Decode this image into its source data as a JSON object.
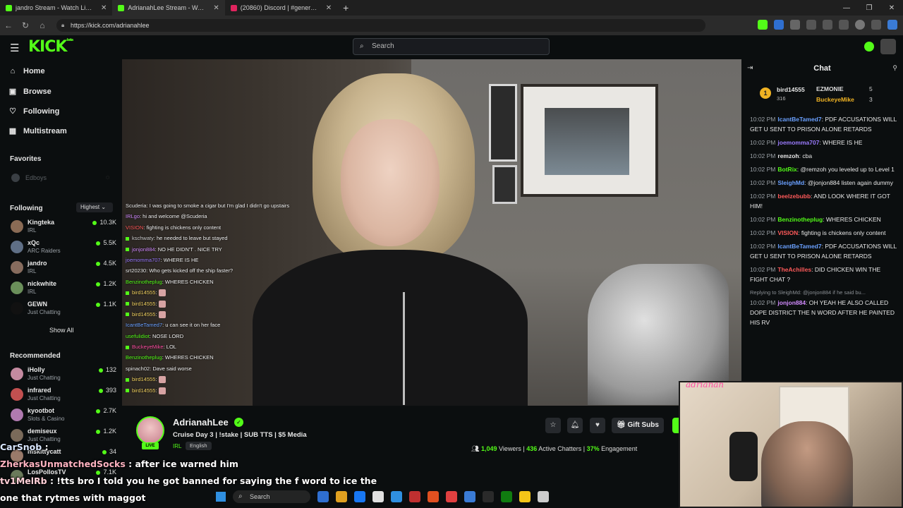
{
  "browser": {
    "tabs": [
      {
        "title": "jandro Stream - Watch Live o",
        "color": "#53fc18",
        "active": false
      },
      {
        "title": "AdrianahLee Stream - Watch",
        "color": "#53fc18",
        "active": true
      },
      {
        "title": "(20860) Discord | #general | H3",
        "color": "#e0245e",
        "active": false
      }
    ],
    "url": "https://kick.com/adrianahlee"
  },
  "header": {
    "logo": "KICK",
    "logo_sup": "beta",
    "search_placeholder": "Search"
  },
  "sidebar": {
    "nav": [
      {
        "label": "Home",
        "icon": "home-icon",
        "glyph": "⌂"
      },
      {
        "label": "Browse",
        "icon": "browse-icon",
        "glyph": "▣"
      },
      {
        "label": "Following",
        "icon": "heart-icon",
        "glyph": "♡"
      },
      {
        "label": "Multistream",
        "icon": "grid-icon",
        "glyph": "▦"
      }
    ],
    "favorites_title": "Favorites",
    "favorite_item": "Edboys",
    "following_title": "Following",
    "sort_label": "Highest",
    "following": [
      {
        "name": "Kingteka",
        "category": "IRL",
        "viewers": "10.3K",
        "color": "#8a6b55"
      },
      {
        "name": "xQc",
        "category": "ARC Raiders",
        "viewers": "5.5K",
        "color": "#5f6f86"
      },
      {
        "name": "jandro",
        "category": "IRL",
        "viewers": "4.5K",
        "color": "#876c5e"
      },
      {
        "name": "nickwhite",
        "category": "IRL",
        "viewers": "1.2K",
        "color": "#6a8f5a"
      },
      {
        "name": "GEWN",
        "category": "Just Chatting",
        "viewers": "1.1K",
        "color": "#111111"
      }
    ],
    "show_all": "Show All",
    "recommended_title": "Recommended",
    "recommended": [
      {
        "name": "iHolly",
        "category": "Just Chatting",
        "viewers": "132",
        "color": "#c48aa0"
      },
      {
        "name": "infrared",
        "category": "Just Chatting",
        "viewers": "393",
        "color": "#c25050"
      },
      {
        "name": "kyootbot",
        "category": "Slots & Casino",
        "viewers": "2.7K",
        "color": "#b07ab0"
      },
      {
        "name": "demiseux",
        "category": "Just Chatting",
        "viewers": "1.2K",
        "color": "#7a6a5a"
      },
      {
        "name": "mskittycatt",
        "category": "",
        "viewers": "34",
        "color": "#9a7a6a"
      },
      {
        "name": "LosPollosTV",
        "category": "",
        "viewers": "7.1K",
        "color": "#6a7a5a"
      }
    ]
  },
  "video_chat": [
    {
      "user": "Scuderia",
      "text": ": I was going to smoke a cigar but I'm glad I didn't go upstairs",
      "color": "#e8e8e8",
      "badge": false,
      "emote": false
    },
    {
      "user": "IRLgo",
      "text": ": hi and welcome @Scuderia",
      "color": "#d28bff",
      "badge": false,
      "emote": false
    },
    {
      "user": "VISION",
      "text": ": fighting is chickens only content",
      "color": "#ff5a5a",
      "badge": false,
      "emote": false
    },
    {
      "user": "kschwaty",
      "text": ": he needed to leave but stayed",
      "color": "#cfcfcf",
      "badge": true,
      "emote": false
    },
    {
      "user": "jonjon884",
      "text": ": NO HE DIDN'T . NICE TRY",
      "color": "#d28bff",
      "badge": true,
      "emote": false
    },
    {
      "user": "joemomma707",
      "text": ": WHERE IS HE",
      "color": "#9b7bff",
      "badge": false,
      "emote": false
    },
    {
      "user": "srt20230",
      "text": ": Who gets kicked off the ship faster?",
      "color": "#e8e8e8",
      "badge": false,
      "emote": false
    },
    {
      "user": "Benzinotheplug",
      "text": ": WHERES CHICKEN",
      "color": "#53fc18",
      "badge": false,
      "emote": false
    },
    {
      "user": "bird14555",
      "text": ":",
      "color": "#f0d060",
      "badge": true,
      "emote": true
    },
    {
      "user": "bird14555",
      "text": ":",
      "color": "#f0d060",
      "badge": true,
      "emote": true
    },
    {
      "user": "bird14555",
      "text": ":",
      "color": "#f0d060",
      "badge": true,
      "emote": true
    },
    {
      "user": "IcantBeTamed7",
      "text": ": u can see it on her face",
      "color": "#6aa0ff",
      "badge": false,
      "emote": false
    },
    {
      "user": "usefulidiot",
      "text": ": NOSE LORD",
      "color": "#53fc18",
      "badge": false,
      "emote": false
    },
    {
      "user": "BuckeyeMike",
      "text": ": LOL",
      "color": "#ff4fa3",
      "badge": true,
      "emote": false
    },
    {
      "user": "Benzinotheplug",
      "text": ": WHERES CHICKEN",
      "color": "#53fc18",
      "badge": false,
      "emote": false
    },
    {
      "user": "spinach02",
      "text": ": Dave said worse",
      "color": "#e8e8e8",
      "badge": false,
      "emote": false
    },
    {
      "user": "bird14555",
      "text": ":",
      "color": "#f0d060",
      "badge": true,
      "emote": true
    },
    {
      "user": "bird14555",
      "text": ":",
      "color": "#f0d060",
      "badge": true,
      "emote": true
    }
  ],
  "chat": {
    "title": "Chat",
    "leaderboard": {
      "first": "bird14555",
      "first_score": "316",
      "second": "EZMONIE",
      "second_count": "5",
      "third": "BuckeyeMike",
      "third_count": "3"
    },
    "messages": [
      {
        "time": "10:02 PM",
        "user": "IcantBeTamed7",
        "text": ": PDF ACCUSATIONS WILL GET U SENT TO PRISON ALONE RETARDS",
        "color": "#6aa0ff",
        "reply": ""
      },
      {
        "time": "10:02 PM",
        "user": "joemomma707",
        "text": ": WHERE IS HE",
        "color": "#9b7bff",
        "reply": ""
      },
      {
        "time": "10:02 PM",
        "user": "remzoh",
        "text": ": cba",
        "color": "#e8e8e8",
        "reply": ""
      },
      {
        "time": "10:02 PM",
        "user": "BotRix",
        "text": ": @remzoh you leveled up to Level 1",
        "color": "#53fc18",
        "reply": ""
      },
      {
        "time": "10:02 PM",
        "user": "SleighMd",
        "text": ": @jonjon884 listen again dummy",
        "color": "#6aa0ff",
        "reply": ""
      },
      {
        "time": "10:02 PM",
        "user": "beelzebubb",
        "text": ": AND LOOK WHERE IT GOT HIM!",
        "color": "#ff5a5a",
        "reply": ""
      },
      {
        "time": "10:02 PM",
        "user": "Benzinotheplug",
        "text": ": WHERES CHICKEN",
        "color": "#53fc18",
        "reply": ""
      },
      {
        "time": "10:02 PM",
        "user": "VISION",
        "text": ": fighting is chickens only content",
        "color": "#ff5a5a",
        "reply": ""
      },
      {
        "time": "10:02 PM",
        "user": "IcantBeTamed7",
        "text": ": PDF ACCUSATIONS WILL GET U SENT TO PRISON ALONE RETARDS",
        "color": "#6aa0ff",
        "reply": ""
      },
      {
        "time": "10:02 PM",
        "user": "TheAchilles",
        "text": ": DID CHICKEN WIN THE FIGHT CHAT ?",
        "color": "#ff5a5a",
        "reply": ""
      },
      {
        "time": "10:02 PM",
        "user": "jonjon884",
        "text": ": OH YEAH HE ALSO CALLED DOPE DISTRICT THE N WORD AFTER HE PAINTED HIS RV",
        "color": "#d28bff",
        "reply": "Replying to SleighMd: @jonjon884 if he said bu..."
      }
    ]
  },
  "stream": {
    "streamer": "AdrianahLee",
    "title": "Cruise Day 3 | !stake | SUB TTS | $5 Media",
    "category": "IRL",
    "language": "English",
    "live_label": "LIVE",
    "gift_label": "Gift Subs",
    "viewers": "1,049",
    "viewers_label": "Viewers",
    "chatters": "436",
    "chatters_label": "Active Chatters",
    "engagement": "37%",
    "engagement_label": "Engagement"
  },
  "webcam_signature": "adrianah",
  "caption_overlay": [
    {
      "user": "CarSnob",
      "text": " :"
    },
    {
      "user": "ZherkasUnmatchedSocks",
      "text": " : after ice warned him"
    },
    {
      "user": "tv1MelRb",
      "text": " : !tts bro I told you he got banned for saying the f word to ice the"
    },
    {
      "user": "",
      "text": "one that rytmes with maggot"
    }
  ],
  "taskbar": {
    "search_label": "Search",
    "icons": [
      "#2f6fd0",
      "#e0a020",
      "#1877f2",
      "#e0e0e0",
      "#2f8fe0",
      "#c03030",
      "#e05020",
      "#e04040",
      "#3a7bd5",
      "#2a2a2a",
      "#107c10",
      "#f5c518",
      "#cccccc"
    ]
  }
}
